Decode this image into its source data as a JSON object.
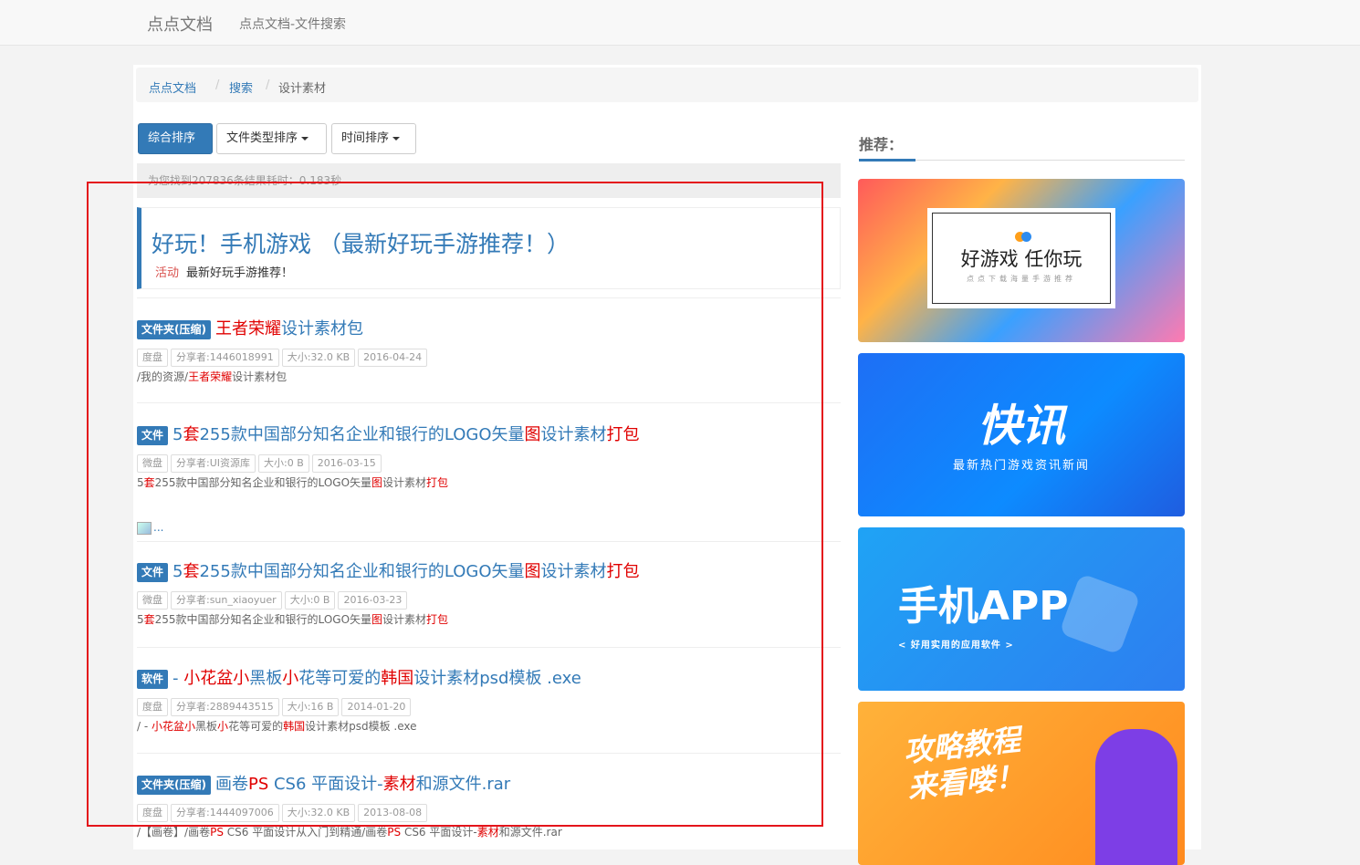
{
  "nav": {
    "brand": "点点文档",
    "link": "点点文档-文件搜索"
  },
  "breadcrumb": [
    "点点文档",
    "搜索",
    "设计素材"
  ],
  "sort": {
    "comprehensive": "综合排序",
    "file_type": "文件类型排序",
    "time": "时间排序"
  },
  "stats": "为您找到207836条结果耗时：0.183秒",
  "promo": {
    "title": "好玩！手机游戏 （最新好玩手游推荐！）",
    "tag": "活动",
    "subtitle": "最新好玩手游推荐！"
  },
  "results": [
    {
      "badge": "文件夹(压缩)",
      "title": [
        {
          "t": "王者荣耀",
          "h": true
        },
        {
          "t": "设计素材包",
          "h": false
        }
      ],
      "meta": [
        "度盘",
        "分享者:1446018991",
        "大小:32.0 KB",
        "2016-04-24"
      ],
      "path": [
        {
          "t": "/我的资源/",
          "h": false
        },
        {
          "t": "王者荣耀",
          "h": true
        },
        {
          "t": "设计素材包",
          "h": false
        }
      ]
    },
    {
      "badge": "文件",
      "title": [
        {
          "t": "5",
          "h": false
        },
        {
          "t": "套",
          "h": true
        },
        {
          "t": "255款中国部分知名企业和银行的LOGO矢量",
          "h": false
        },
        {
          "t": "图",
          "h": true
        },
        {
          "t": "设计素材",
          "h": false
        },
        {
          "t": "打包",
          "h": true
        }
      ],
      "meta": [
        "微盘",
        "分享者:UI资源库",
        "大小:0 B",
        "2016-03-15"
      ],
      "path": [
        {
          "t": "5",
          "h": false
        },
        {
          "t": "套",
          "h": true
        },
        {
          "t": "255款中国部分知名企业和银行的LOGO矢量",
          "h": false
        },
        {
          "t": "图",
          "h": true
        },
        {
          "t": "设计素材",
          "h": false
        },
        {
          "t": "打包",
          "h": true
        }
      ]
    },
    {
      "badge": "文件",
      "title": [
        {
          "t": "5",
          "h": false
        },
        {
          "t": "套",
          "h": true
        },
        {
          "t": "255款中国部分知名企业和银行的LOGO矢量",
          "h": false
        },
        {
          "t": "图",
          "h": true
        },
        {
          "t": "设计素材",
          "h": false
        },
        {
          "t": "打包",
          "h": true
        }
      ],
      "meta": [
        "微盘",
        "分享者:sun_xiaoyuer",
        "大小:0 B",
        "2016-03-23"
      ],
      "path": [
        {
          "t": "5",
          "h": false
        },
        {
          "t": "套",
          "h": true
        },
        {
          "t": "255款中国部分知名企业和银行的LOGO矢量",
          "h": false
        },
        {
          "t": "图",
          "h": true
        },
        {
          "t": "设计素材",
          "h": false
        },
        {
          "t": "打包",
          "h": true
        }
      ]
    },
    {
      "badge": "软件",
      "title": [
        {
          "t": "- ",
          "h": false
        },
        {
          "t": "小花盆小",
          "h": true
        },
        {
          "t": "黑板",
          "h": false
        },
        {
          "t": "小",
          "h": true
        },
        {
          "t": "花等可爱的",
          "h": false
        },
        {
          "t": "韩国",
          "h": true
        },
        {
          "t": "设计素材psd模板 .exe",
          "h": false
        }
      ],
      "meta": [
        "度盘",
        "分享者:2889443515",
        "大小:16 B",
        "2014-01-20"
      ],
      "path": [
        {
          "t": "/ - ",
          "h": false
        },
        {
          "t": "小花盆小",
          "h": true
        },
        {
          "t": "黑板",
          "h": false
        },
        {
          "t": "小",
          "h": true
        },
        {
          "t": "花等可爱的",
          "h": false
        },
        {
          "t": "韩国",
          "h": true
        },
        {
          "t": "设计素材psd模板 .exe",
          "h": false
        }
      ]
    },
    {
      "badge": "文件夹(压缩)",
      "title": [
        {
          "t": "画卷",
          "h": false
        },
        {
          "t": "PS",
          "h": true
        },
        {
          "t": " CS6 平面设计-",
          "h": false
        },
        {
          "t": "素材",
          "h": true
        },
        {
          "t": "和源文件.rar",
          "h": false
        }
      ],
      "meta": [
        "度盘",
        "分享者:1444097006",
        "大小:32.0 KB",
        "2013-08-08"
      ],
      "path": [
        {
          "t": "/【画卷】/画卷",
          "h": false
        },
        {
          "t": "PS",
          "h": true
        },
        {
          "t": " CS6 平面设计从入门到精通/画卷",
          "h": false
        },
        {
          "t": "PS",
          "h": true
        },
        {
          "t": " CS6 平面设计-",
          "h": false
        },
        {
          "t": "素材",
          "h": true
        },
        {
          "t": "和源文件.rar",
          "h": false
        }
      ]
    }
  ],
  "broken_image_alt": "...",
  "recommend": {
    "title": "推荐：",
    "banners": [
      {
        "title": "好游戏 任你玩",
        "subtitle": "点点下载海量手游推荐"
      },
      {
        "title": "快讯",
        "subtitle": "最新热门游戏资讯新闻"
      },
      {
        "title": "手机APP",
        "subtitle": "< 好用实用的应用软件 >"
      },
      {
        "title": "攻略教程\n来看喽！"
      }
    ]
  },
  "colors": {
    "primary": "#337ab7",
    "highlight": "#e00000",
    "annotation": "#e4141b"
  }
}
